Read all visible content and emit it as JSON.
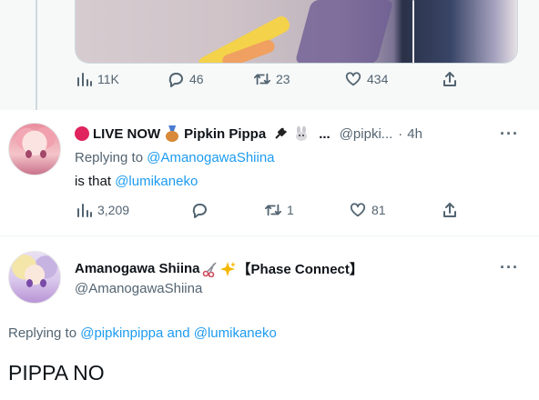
{
  "top_tweet": {
    "stats": {
      "views": "11K",
      "replies": "46",
      "retweets": "23",
      "likes": "434"
    }
  },
  "reply_tweet": {
    "live_label": "LIVE NOW",
    "display_name": "Pipkin Pippa",
    "ellipsis": "...",
    "handle": "@pipki...",
    "separator": "·",
    "time": "4h",
    "replying_prefix": "Replying to",
    "replying_to": "@AmanogawaShiina",
    "body_prefix": "is that",
    "body_mention": "@lumikaneko",
    "stats": {
      "views": "3,209",
      "replies": "",
      "retweets": "1",
      "likes": "81"
    }
  },
  "main_tweet": {
    "display_name": "Amanogawa Shiina",
    "name_suffix": "【Phase Connect】",
    "handle": "@AmanogawaShiina",
    "replying_prefix": "Replying to",
    "replying_to_1": "@pipkinpippa",
    "replying_and": "and",
    "replying_to_2": "@lumikaneko",
    "body": "PIPPA NO"
  },
  "more_icon_label": "···",
  "colors": {
    "accent": "#1d9bf0",
    "muted": "#536471",
    "live_red": "#e0245e"
  }
}
